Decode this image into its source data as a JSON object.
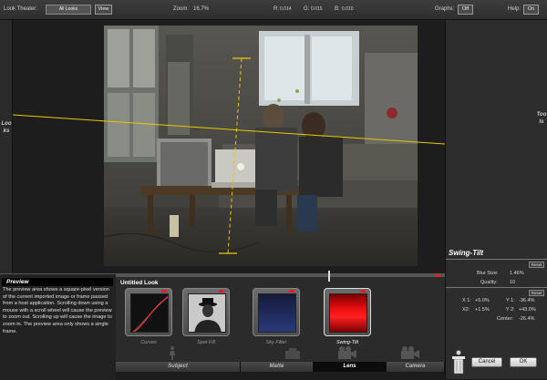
{
  "topbar": {
    "look_theater_label": "Look Theater:",
    "look_select_value": "All Looks",
    "view_button": "View",
    "zoom_label": "Zoom:",
    "zoom_value": "16.7%",
    "r_label": "R:",
    "r_value": "0.014",
    "g_label": "G:",
    "g_value": "0.015",
    "b_label": "B:",
    "b_value": "0.010",
    "graphs_label": "Graphs:",
    "graphs_value": "Off",
    "help_label": "Help:",
    "help_value": "On"
  },
  "left_rail": {
    "label": "Looks"
  },
  "right_rail": {
    "label": "Tools"
  },
  "tool_panel": {
    "title": "Swing-Tilt",
    "reset_label": "Reset",
    "blur_size_label": "Blur Size:",
    "blur_size_value": "1.46%",
    "quality_label": "Quality:",
    "quality_value": "10",
    "x1_label": "X 1:",
    "x1_value": "+5.0%",
    "y1_label": "Y 1:",
    "y1_value": "-36.4%",
    "x2_label": "X2:",
    "x2_value": "+1.5%",
    "y2_label": "Y 2:",
    "y2_value": "+43.0%",
    "center_label": "Center:",
    "center_value": "-26.4%"
  },
  "help_box": {
    "title": "Preview",
    "text": "The preview area shows a square-pixel version of the current imported image or frame passed from a host application. Scrolling down using a mouse with a scroll wheel will cause the preview to zoom out. Scrolling up will cause the image to zoom in. The preview area only shows a single frame."
  },
  "look_builder": {
    "title": "Untitled Look",
    "tools": [
      {
        "label": "Curves"
      },
      {
        "label": "Spot Fill"
      },
      {
        "label": "Sky Filter"
      },
      {
        "label": "Swing-Tilt"
      }
    ],
    "tabs": [
      "Subject",
      "Matte",
      "Lens",
      "Camera"
    ],
    "active_tab": "Lens"
  },
  "buttons": {
    "cancel": "Cancel",
    "ok": "OK"
  },
  "colors": {
    "overlay_line": "#e8c800",
    "accent_red": "#d22222",
    "selected_tool": "#cc0000"
  }
}
